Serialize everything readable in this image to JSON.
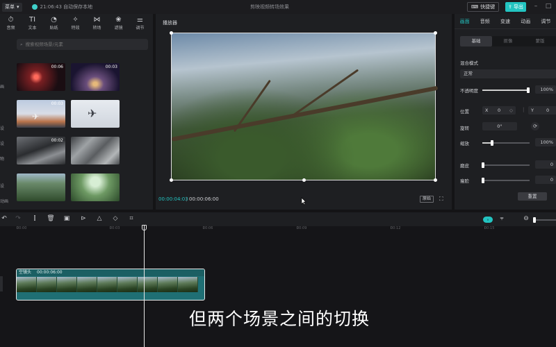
{
  "topbar": {
    "menu_label": "菜单",
    "save_status": "21:06:43 自动保存本地",
    "project_title": "剪映视频转场效果",
    "shortcut_label": "快捷键",
    "export_label": "导出"
  },
  "tools": [
    {
      "icon": "⏱",
      "label": "音频",
      "icon_name": "audio-icon"
    },
    {
      "icon": "TI",
      "label": "文本",
      "icon_name": "text-icon"
    },
    {
      "icon": "◔",
      "label": "贴纸",
      "icon_name": "sticker-icon"
    },
    {
      "icon": "✧",
      "label": "特效",
      "icon_name": "effects-icon"
    },
    {
      "icon": "⋈",
      "label": "转场",
      "icon_name": "transition-icon"
    },
    {
      "icon": "❀",
      "label": "滤镜",
      "icon_name": "filter-icon"
    },
    {
      "icon": "⚌",
      "label": "调节",
      "icon_name": "adjust-icon"
    }
  ],
  "side_categories": [
    "画",
    "设",
    "设",
    "物",
    "设",
    "动画"
  ],
  "search": {
    "placeholder": "搜索视频场景/元素"
  },
  "thumbnails": [
    {
      "duration": "00:06"
    },
    {
      "duration": "00:03"
    },
    {
      "duration": "00:03"
    },
    {
      "duration": ""
    },
    {
      "duration": "00:02"
    },
    {
      "duration": ""
    },
    {
      "duration": ""
    },
    {
      "duration": ""
    }
  ],
  "player": {
    "title": "播放器",
    "current_time": "00:00:04:03",
    "total_time": "00:00:06:00",
    "original_label": "原始"
  },
  "right_panel": {
    "tabs": [
      "画面",
      "音频",
      "变速",
      "动画",
      "调节"
    ],
    "subtabs": [
      "基础",
      "抠像",
      "蒙版"
    ],
    "blend_label": "混合模式",
    "blend_value": "正常",
    "opacity_label": "不透明度",
    "opacity_value": "100%",
    "opacity_fraction": 1.0,
    "position_label": "位置",
    "pos_x_label": "X",
    "pos_x": "0",
    "pos_y_label": "Y",
    "pos_y": "0",
    "rotation_label": "旋转",
    "rotation_value": "0°",
    "scale_label": "缩放",
    "scale_value": "100%",
    "sharpen_label": "磨皮",
    "sharpen_value": "0",
    "thin_label": "瘦脸",
    "thin_value": "0",
    "reset_label": "重置"
  },
  "timeline": {
    "ticks": [
      "00:00",
      "00:03",
      "00:06",
      "00:09",
      "00:12",
      "00:15"
    ],
    "clip_name": "空镜头",
    "clip_duration": "00:00:06:00"
  },
  "subtitle": "但两个场景之间的切换"
}
